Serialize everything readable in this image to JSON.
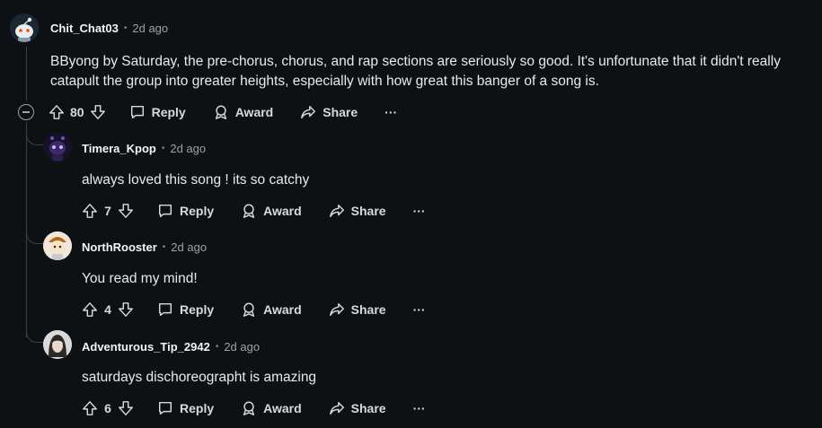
{
  "comments": [
    {
      "username": "Chit_Chat03",
      "time": "2d ago",
      "body_line1": "BByong by Saturday, the pre-chorus, chorus, and rap sections are seriously so good. It's unfortunate that it didn't really",
      "body_line2": "catapult the group into greater heights, especially with how great this banger of a song is.",
      "votes": "80"
    },
    {
      "username": "Timera_Kpop",
      "time": "2d ago",
      "body": "always loved this song ! its so catchy",
      "votes": "7"
    },
    {
      "username": "NorthRooster",
      "time": "2d ago",
      "body": "You read my mind!",
      "votes": "4"
    },
    {
      "username": "Adventurous_Tip_2942",
      "time": "2d ago",
      "body": "saturdays dischoreographt is amazing",
      "votes": "6"
    }
  ],
  "labels": {
    "dot": "•",
    "reply": "Reply",
    "award": "Award",
    "share": "Share",
    "more": "···"
  },
  "colors": {
    "background": "#0e1113",
    "text": "#d7dadc",
    "muted": "#9ea2a5",
    "thread_line": "#3e4244"
  },
  "icons": [
    "snoo-avatar",
    "upvote-icon",
    "downvote-icon",
    "comment-icon",
    "award-icon",
    "share-icon",
    "more-icon",
    "collapse-icon"
  ]
}
